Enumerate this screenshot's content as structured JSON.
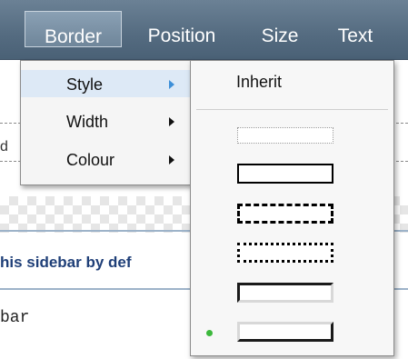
{
  "menubar": {
    "tabs": [
      {
        "label": "Border"
      },
      {
        "label": "Position"
      },
      {
        "label": "Size"
      },
      {
        "label": "Text"
      }
    ],
    "active_tab": "Border"
  },
  "dropdown": {
    "items": [
      {
        "label": "Style",
        "active": true
      },
      {
        "label": "Width",
        "active": false
      },
      {
        "label": "Colour",
        "active": false
      }
    ]
  },
  "submenu": {
    "inherit_label": "Inherit",
    "styles": [
      {
        "name": "dotted-light"
      },
      {
        "name": "solid"
      },
      {
        "name": "dashed"
      },
      {
        "name": "dotted"
      },
      {
        "name": "inset"
      },
      {
        "name": "outset",
        "selected": true
      }
    ],
    "selected_color": "#3cb83c"
  },
  "background": {
    "sidebar_text": "his sidebar by def",
    "mono_text": "bar",
    "left_fragment": "d"
  },
  "colors": {
    "menubar": "#546b80",
    "active_menu_item": "#dde9f6",
    "submenu_arrow_active": "#3d8fd8",
    "link_text": "#1f3f78"
  }
}
